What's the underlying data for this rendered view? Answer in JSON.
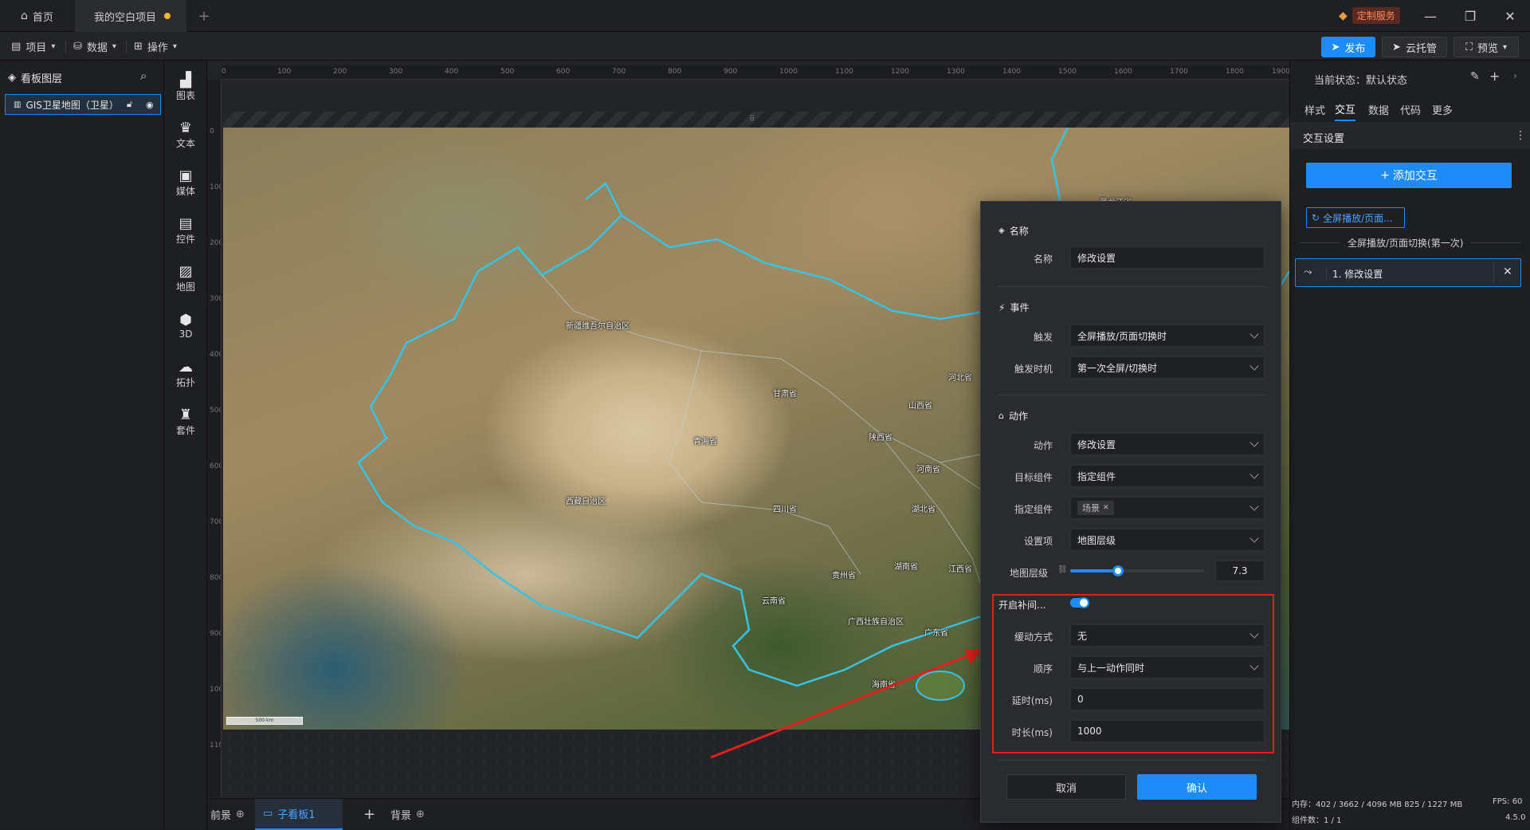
{
  "titlebar": {
    "home_tab": "首页",
    "project_tab": "我的空白项目",
    "custom_service": "定制服务"
  },
  "menubar": {
    "project": "项目",
    "data": "数据",
    "operate": "操作",
    "publish": "发布",
    "cloud_host": "云托管",
    "preview": "预览"
  },
  "layers": {
    "title": "看板图层",
    "items": [
      {
        "label": "GIS卫星地图（卫星）"
      }
    ]
  },
  "tools": [
    {
      "label": "图表",
      "icon": "chart-icon"
    },
    {
      "label": "文本",
      "icon": "text-icon"
    },
    {
      "label": "媒体",
      "icon": "media-icon"
    },
    {
      "label": "控件",
      "icon": "control-icon"
    },
    {
      "label": "地图",
      "icon": "map-icon"
    },
    {
      "label": "3D",
      "icon": "cube-icon"
    },
    {
      "label": "拓扑",
      "icon": "topology-icon"
    },
    {
      "label": "套件",
      "icon": "kit-icon"
    }
  ],
  "ruler": {
    "top": [
      "0",
      "100",
      "200",
      "300",
      "400",
      "500",
      "600",
      "700",
      "800",
      "900",
      "1000",
      "1100",
      "1200",
      "1300",
      "1400",
      "1500",
      "1600",
      "1700",
      "1800",
      "1900"
    ],
    "left": [
      "0",
      "100",
      "200",
      "300",
      "400",
      "500",
      "600",
      "700",
      "800",
      "900",
      "1000",
      "1100"
    ]
  },
  "map": {
    "labels": {
      "xinjiang": "新疆维吾尔自治区",
      "gansu": "甘肃省",
      "qinghai": "青海省",
      "xizang": "西藏自治区",
      "sichuan": "四川省",
      "yunnan": "云南省",
      "guizhou": "贵州省",
      "guangxi": "广西壮族自治区",
      "guangdong": "广东省",
      "hainan": "海南省",
      "hunan": "湖南省",
      "hubei": "湖北省",
      "jiangxi": "江西省",
      "henan": "河南省",
      "shaanxi": "陕西省",
      "shanxi": "山西省",
      "hebei": "河北省",
      "heilongjiang": "黑龙江省"
    },
    "scale": "500 km"
  },
  "bottom": {
    "front": "前景",
    "sub": "子看板1",
    "back": "背景"
  },
  "right": {
    "state_label": "当前状态：",
    "state_value": "默认状态",
    "tabs": [
      "样式",
      "交互",
      "数据",
      "代码",
      "更多"
    ],
    "section": "交互设置",
    "add_button": "添加交互",
    "chip": "全屏播放/页面...",
    "group_title": "全屏播放/页面切换(第一次)",
    "action_item": "1. 修改设置",
    "mem_label": "内存：",
    "mem_value": "402 / 3662 / 4096 MB   825 / 1227 MB",
    "fps_label": "FPS:",
    "fps_value": "60",
    "count_label": "组件数：",
    "count_value": "1 / 1",
    "version": "4.5.0"
  },
  "dialog": {
    "name_section": "名称",
    "name_label": "名称",
    "name_value": "修改设置",
    "event_section": "事件",
    "trigger_label": "触发",
    "trigger_value": "全屏播放/页面切换时",
    "timing_label": "触发时机",
    "timing_value": "第一次全屏/切换时",
    "action_section": "动作",
    "action_label": "动作",
    "action_value": "修改设置",
    "target_label": "目标组件",
    "target_value": "指定组件",
    "specify_label": "指定组件",
    "specify_tag": "场景",
    "setting_label": "设置项",
    "setting_value": "地图层级",
    "level_label": "地图层级",
    "level_value": "7.3",
    "level_fraction": 0.36,
    "tween_label": "开启补间...",
    "tween_on": true,
    "easing_label": "缓动方式",
    "easing_value": "无",
    "order_label": "顺序",
    "order_value": "与上一动作同时",
    "delay_label": "延时(ms)",
    "delay_value": "0",
    "duration_label": "时长(ms)",
    "duration_value": "1000",
    "cancel": "取消",
    "confirm": "确认"
  },
  "colors": {
    "accent": "#1d8cf8",
    "highlight_box": "#e0201c",
    "border_cyan": "#37c3e6"
  }
}
